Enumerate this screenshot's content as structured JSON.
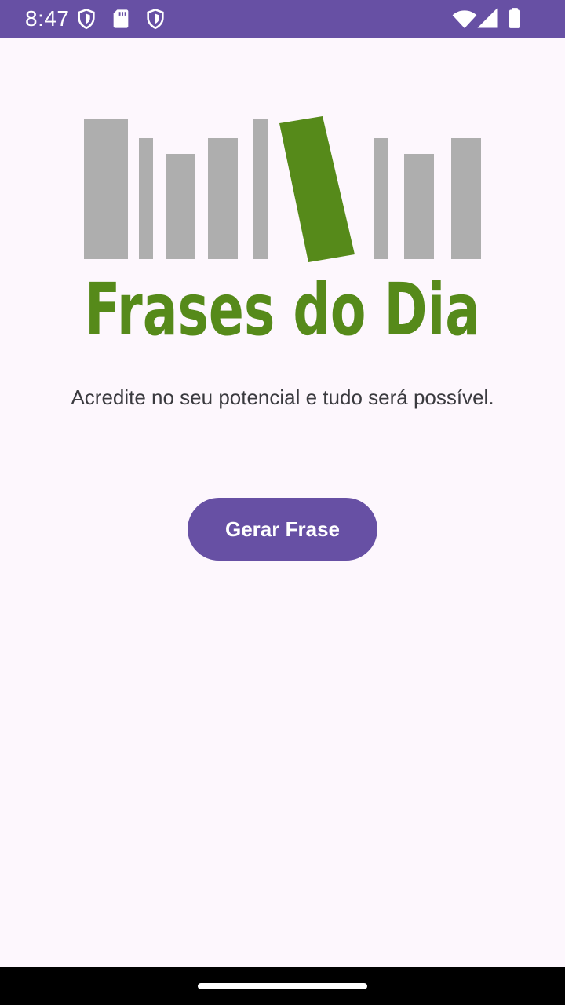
{
  "status_bar": {
    "time": "8:47",
    "left_icons": [
      "shield-icon",
      "sd-card-icon",
      "shield-icon"
    ],
    "right_icons": [
      "wifi-icon",
      "signal-icon",
      "battery-icon"
    ],
    "background": "#6750a4"
  },
  "logo": {
    "text": "Frases do Dia",
    "text_color": "#568a1a",
    "bars_color": "#aeaeae",
    "accent_bar_color": "#568a1a"
  },
  "main": {
    "quote": "Acredite no seu potencial e tudo será possível.",
    "generate_button_label": "Gerar Frase",
    "accent_color": "#6750a4"
  }
}
